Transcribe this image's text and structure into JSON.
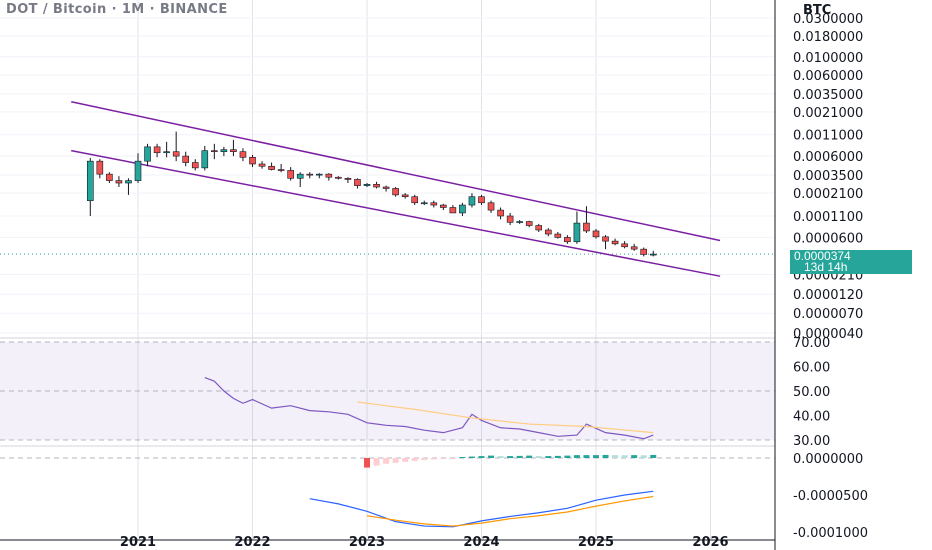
{
  "header": {
    "symbol": "DOT / Bitcoin",
    "interval": "1M",
    "exchange": "BINANCE",
    "currency": "BTC"
  },
  "price_axis_labels": [
    "0.0300000",
    "0.0180000",
    "0.0100000",
    "0.0060000",
    "0.0035000",
    "0.0021000",
    "0.0011000",
    "0.0006000",
    "0.0003500",
    "0.0002100",
    "0.0001100",
    "0.0000600",
    "0.0000210",
    "0.0000120",
    "0.0000070",
    "0.0000040"
  ],
  "last_price": {
    "value": "0.0000374",
    "countdown": "13d 14h"
  },
  "rsi_axis_labels": [
    "70.00",
    "60.00",
    "50.00",
    "40.00",
    "30.00"
  ],
  "hist_axis_labels": [
    "0.0000000",
    "-0.0000500",
    "-0.0001000"
  ],
  "x_axis_labels": [
    "2021",
    "2022",
    "2023",
    "2024",
    "2025",
    "2026"
  ],
  "colors": {
    "up": "#26a69a",
    "down": "#ef5350",
    "channel": "#7b1fa2",
    "rsi": "#7e57c2",
    "rsi_ma": "#ffcc80",
    "macd": "#2962ff",
    "signal": "#ff9800",
    "hist_pos": "#26a69a",
    "hist_pos_light": "#b2dfdb",
    "hist_neg": "#ef5350",
    "hist_neg_light": "#ffcdd2",
    "rsi_band": "#7e57c2"
  },
  "chart_data": {
    "type": "candlestick",
    "title": "DOT / Bitcoin · 1M · BINANCE",
    "scale": "log",
    "x_range": [
      "2020-06",
      "2026-05"
    ],
    "y_range": [
      4e-06,
      0.03
    ],
    "candles": [
      {
        "t": "2020-08",
        "o": 0.00017,
        "h": 0.00057,
        "l": 0.00011,
        "c": 0.00052
      },
      {
        "t": "2020-09",
        "o": 0.00052,
        "h": 0.00055,
        "l": 0.00032,
        "c": 0.00036
      },
      {
        "t": "2020-10",
        "o": 0.00036,
        "h": 0.00038,
        "l": 0.00028,
        "c": 0.0003
      },
      {
        "t": "2020-11",
        "o": 0.0003,
        "h": 0.00034,
        "l": 0.00025,
        "c": 0.00028
      },
      {
        "t": "2020-12",
        "o": 0.00028,
        "h": 0.00032,
        "l": 0.0002,
        "c": 0.0003
      },
      {
        "t": "2021-01",
        "o": 0.0003,
        "h": 0.00065,
        "l": 0.00028,
        "c": 0.00052
      },
      {
        "t": "2021-02",
        "o": 0.00052,
        "h": 0.00085,
        "l": 0.00045,
        "c": 0.00078
      },
      {
        "t": "2021-03",
        "o": 0.00078,
        "h": 0.00085,
        "l": 0.00058,
        "c": 0.00066
      },
      {
        "t": "2021-04",
        "o": 0.00066,
        "h": 0.0009,
        "l": 0.00058,
        "c": 0.00068
      },
      {
        "t": "2021-05",
        "o": 0.00068,
        "h": 0.0012,
        "l": 0.00052,
        "c": 0.0006
      },
      {
        "t": "2021-06",
        "o": 0.0006,
        "h": 0.00068,
        "l": 0.00045,
        "c": 0.0005
      },
      {
        "t": "2021-07",
        "o": 0.0005,
        "h": 0.00055,
        "l": 0.0004,
        "c": 0.00043
      },
      {
        "t": "2021-08",
        "o": 0.00043,
        "h": 0.0008,
        "l": 0.0004,
        "c": 0.0007
      },
      {
        "t": "2021-09",
        "o": 0.0007,
        "h": 0.00085,
        "l": 0.00055,
        "c": 0.00068
      },
      {
        "t": "2021-10",
        "o": 0.00068,
        "h": 0.00078,
        "l": 0.0006,
        "c": 0.00072
      },
      {
        "t": "2021-11",
        "o": 0.00072,
        "h": 0.00095,
        "l": 0.0006,
        "c": 0.00068
      },
      {
        "t": "2021-12",
        "o": 0.00068,
        "h": 0.00075,
        "l": 0.00052,
        "c": 0.00058
      },
      {
        "t": "2022-01",
        "o": 0.00058,
        "h": 0.00062,
        "l": 0.00044,
        "c": 0.00048
      },
      {
        "t": "2022-02",
        "o": 0.00048,
        "h": 0.00052,
        "l": 0.00042,
        "c": 0.00045
      },
      {
        "t": "2022-03",
        "o": 0.00045,
        "h": 0.0005,
        "l": 0.0004,
        "c": 0.00041
      },
      {
        "t": "2022-04",
        "o": 0.00041,
        "h": 0.00048,
        "l": 0.00038,
        "c": 0.0004
      },
      {
        "t": "2022-05",
        "o": 0.0004,
        "h": 0.00044,
        "l": 0.0003,
        "c": 0.00032
      },
      {
        "t": "2022-06",
        "o": 0.00032,
        "h": 0.00038,
        "l": 0.00025,
        "c": 0.00036
      },
      {
        "t": "2022-07",
        "o": 0.00036,
        "h": 0.00038,
        "l": 0.00032,
        "c": 0.00035
      },
      {
        "t": "2022-08",
        "o": 0.00035,
        "h": 0.00037,
        "l": 0.00032,
        "c": 0.00036
      },
      {
        "t": "2022-09",
        "o": 0.00036,
        "h": 0.00037,
        "l": 0.0003,
        "c": 0.00033
      },
      {
        "t": "2022-10",
        "o": 0.00033,
        "h": 0.00034,
        "l": 0.00031,
        "c": 0.00032
      },
      {
        "t": "2022-11",
        "o": 0.00032,
        "h": 0.00033,
        "l": 0.00028,
        "c": 0.00031
      },
      {
        "t": "2022-12",
        "o": 0.00031,
        "h": 0.00032,
        "l": 0.00024,
        "c": 0.00026
      },
      {
        "t": "2023-01",
        "o": 0.00026,
        "h": 0.00028,
        "l": 0.00025,
        "c": 0.00027
      },
      {
        "t": "2023-02",
        "o": 0.00027,
        "h": 0.00029,
        "l": 0.00024,
        "c": 0.00025
      },
      {
        "t": "2023-03",
        "o": 0.00025,
        "h": 0.00026,
        "l": 0.00022,
        "c": 0.00024
      },
      {
        "t": "2023-04",
        "o": 0.00024,
        "h": 0.00025,
        "l": 0.00019,
        "c": 0.0002
      },
      {
        "t": "2023-05",
        "o": 0.0002,
        "h": 0.00021,
        "l": 0.00018,
        "c": 0.00019
      },
      {
        "t": "2023-06",
        "o": 0.00019,
        "h": 0.0002,
        "l": 0.00015,
        "c": 0.00016
      },
      {
        "t": "2023-07",
        "o": 0.00016,
        "h": 0.00017,
        "l": 0.00015,
        "c": 0.00016
      },
      {
        "t": "2023-08",
        "o": 0.00016,
        "h": 0.00017,
        "l": 0.00014,
        "c": 0.00015
      },
      {
        "t": "2023-09",
        "o": 0.00015,
        "h": 0.000155,
        "l": 0.00013,
        "c": 0.00014
      },
      {
        "t": "2023-10",
        "o": 0.00014,
        "h": 0.00015,
        "l": 0.00012,
        "c": 0.00012
      },
      {
        "t": "2023-11",
        "o": 0.00012,
        "h": 0.00016,
        "l": 0.00011,
        "c": 0.00015
      },
      {
        "t": "2023-12",
        "o": 0.00015,
        "h": 0.00021,
        "l": 0.00014,
        "c": 0.00019
      },
      {
        "t": "2024-01",
        "o": 0.00019,
        "h": 0.0002,
        "l": 0.00015,
        "c": 0.00016
      },
      {
        "t": "2024-02",
        "o": 0.00016,
        "h": 0.00017,
        "l": 0.00012,
        "c": 0.00013
      },
      {
        "t": "2024-03",
        "o": 0.00013,
        "h": 0.00014,
        "l": 0.0001,
        "c": 0.00011
      },
      {
        "t": "2024-04",
        "o": 0.00011,
        "h": 0.00012,
        "l": 8.5e-05,
        "c": 9.2e-05
      },
      {
        "t": "2024-05",
        "o": 9.2e-05,
        "h": 9.8e-05,
        "l": 8.8e-05,
        "c": 9.4e-05
      },
      {
        "t": "2024-06",
        "o": 9.4e-05,
        "h": 9.6e-05,
        "l": 8e-05,
        "c": 8.4e-05
      },
      {
        "t": "2024-07",
        "o": 8.4e-05,
        "h": 8.8e-05,
        "l": 7e-05,
        "c": 7.4e-05
      },
      {
        "t": "2024-08",
        "o": 7.4e-05,
        "h": 7.8e-05,
        "l": 6.2e-05,
        "c": 6.6e-05
      },
      {
        "t": "2024-09",
        "o": 6.6e-05,
        "h": 7e-05,
        "l": 5.8e-05,
        "c": 6e-05
      },
      {
        "t": "2024-10",
        "o": 6e-05,
        "h": 6.4e-05,
        "l": 5e-05,
        "c": 5.3e-05
      },
      {
        "t": "2024-11",
        "o": 5.3e-05,
        "h": 0.000125,
        "l": 5e-05,
        "c": 9e-05
      },
      {
        "t": "2024-12",
        "o": 9e-05,
        "h": 0.000145,
        "l": 6.8e-05,
        "c": 7.2e-05
      },
      {
        "t": "2025-01",
        "o": 7.2e-05,
        "h": 7.6e-05,
        "l": 5.8e-05,
        "c": 6.1e-05
      },
      {
        "t": "2025-02",
        "o": 6.1e-05,
        "h": 6.4e-05,
        "l": 4.3e-05,
        "c": 5.4e-05
      },
      {
        "t": "2025-03",
        "o": 5.4e-05,
        "h": 5.8e-05,
        "l": 4.8e-05,
        "c": 5e-05
      },
      {
        "t": "2025-04",
        "o": 5e-05,
        "h": 5.4e-05,
        "l": 4.4e-05,
        "c": 4.6e-05
      },
      {
        "t": "2025-05",
        "o": 4.6e-05,
        "h": 5e-05,
        "l": 4.1e-05,
        "c": 4.3e-05
      },
      {
        "t": "2025-06",
        "o": 4.3e-05,
        "h": 4.5e-05,
        "l": 3.5e-05,
        "c": 3.7e-05
      },
      {
        "t": "2025-07",
        "o": 3.7e-05,
        "h": 4.1e-05,
        "l": 3.5e-05,
        "c": 3.74e-05
      }
    ],
    "channel_lines": [
      {
        "from": {
          "t": "2020-06",
          "v": 0.0028
        },
        "to": {
          "t": "2026-02",
          "v": 5.5e-05
        }
      },
      {
        "from": {
          "t": "2020-06",
          "v": 0.0007
        },
        "to": {
          "t": "2026-02",
          "v": 2e-05
        }
      }
    ],
    "rsi": {
      "band": [
        30,
        70
      ],
      "mid": 50,
      "ylim": [
        27,
        72
      ],
      "x": [
        "2021-08",
        "2021-09",
        "2021-10",
        "2021-11",
        "2021-12",
        "2022-01",
        "2022-03",
        "2022-05",
        "2022-07",
        "2022-09",
        "2022-11",
        "2023-01",
        "2023-03",
        "2023-05",
        "2023-07",
        "2023-09",
        "2023-11",
        "2023-12",
        "2024-01",
        "2024-03",
        "2024-05",
        "2024-07",
        "2024-09",
        "2024-11",
        "2024-12",
        "2025-02",
        "2025-04",
        "2025-06",
        "2025-07"
      ],
      "values": [
        55.5,
        54,
        50,
        47,
        45,
        46.5,
        43,
        44,
        42,
        41.5,
        40.5,
        37,
        36,
        35.5,
        34,
        33,
        35,
        40.5,
        38,
        35,
        34.5,
        33,
        31.5,
        32,
        36.5,
        33,
        32,
        30.5,
        32
      ],
      "ma_x": [
        "2022-12",
        "2023-06",
        "2023-12",
        "2024-06",
        "2024-12",
        "2025-07"
      ],
      "ma_values": [
        45.5,
        42.5,
        39,
        36.5,
        35.5,
        33
      ]
    },
    "histogram": {
      "ylim": [
        -0.0001,
        1e-05
      ],
      "x": [
        "2023-01",
        "2023-02",
        "2023-03",
        "2023-04",
        "2023-05",
        "2023-06",
        "2023-07",
        "2023-08",
        "2023-09",
        "2023-10",
        "2023-11",
        "2023-12",
        "2024-01",
        "2024-02",
        "2024-03",
        "2024-04",
        "2024-05",
        "2024-06",
        "2024-07",
        "2024-08",
        "2024-09",
        "2024-10",
        "2024-11",
        "2024-12",
        "2025-01",
        "2025-02",
        "2025-03",
        "2025-04",
        "2025-05",
        "2025-06",
        "2025-07"
      ],
      "values": [
        -1e-05,
        -8e-06,
        -6e-06,
        -5e-06,
        -4e-06,
        -3e-06,
        -2e-06,
        -1.5e-06,
        -1e-06,
        -5e-07,
        1e-06,
        1.5e-06,
        2e-06,
        2.5e-06,
        2e-06,
        2e-06,
        2.2e-06,
        2.5e-06,
        2e-06,
        2e-06,
        2.2e-06,
        2.5e-06,
        3e-06,
        3e-06,
        3e-06,
        3.2e-06,
        3e-06,
        2.8e-06,
        3e-06,
        2.8e-06,
        3.2e-06
      ]
    },
    "macd": {
      "x": [
        "2022-07",
        "2022-10",
        "2023-01",
        "2023-04",
        "2023-07",
        "2023-10",
        "2024-01",
        "2024-04",
        "2024-07",
        "2024-10",
        "2025-01",
        "2025-04",
        "2025-07"
      ],
      "values": [
        -5.5e-05,
        -6.2e-05,
        -7.2e-05,
        -8.6e-05,
        -9.2e-05,
        -9.3e-05,
        -8.5e-05,
        -7.9e-05,
        -7.4e-05,
        -6.8e-05,
        -5.7e-05,
        -5e-05,
        -4.5e-05
      ]
    },
    "signal": {
      "x": [
        "2023-01",
        "2023-04",
        "2023-07",
        "2023-10",
        "2024-01",
        "2024-04",
        "2024-07",
        "2024-10",
        "2025-01",
        "2025-04",
        "2025-07"
      ],
      "values": [
        -7.8e-05,
        -8.4e-05,
        -8.9e-05,
        -9.2e-05,
        -8.8e-05,
        -8.2e-05,
        -7.8e-05,
        -7.3e-05,
        -6.5e-05,
        -5.8e-05,
        -5.2e-05
      ]
    }
  }
}
